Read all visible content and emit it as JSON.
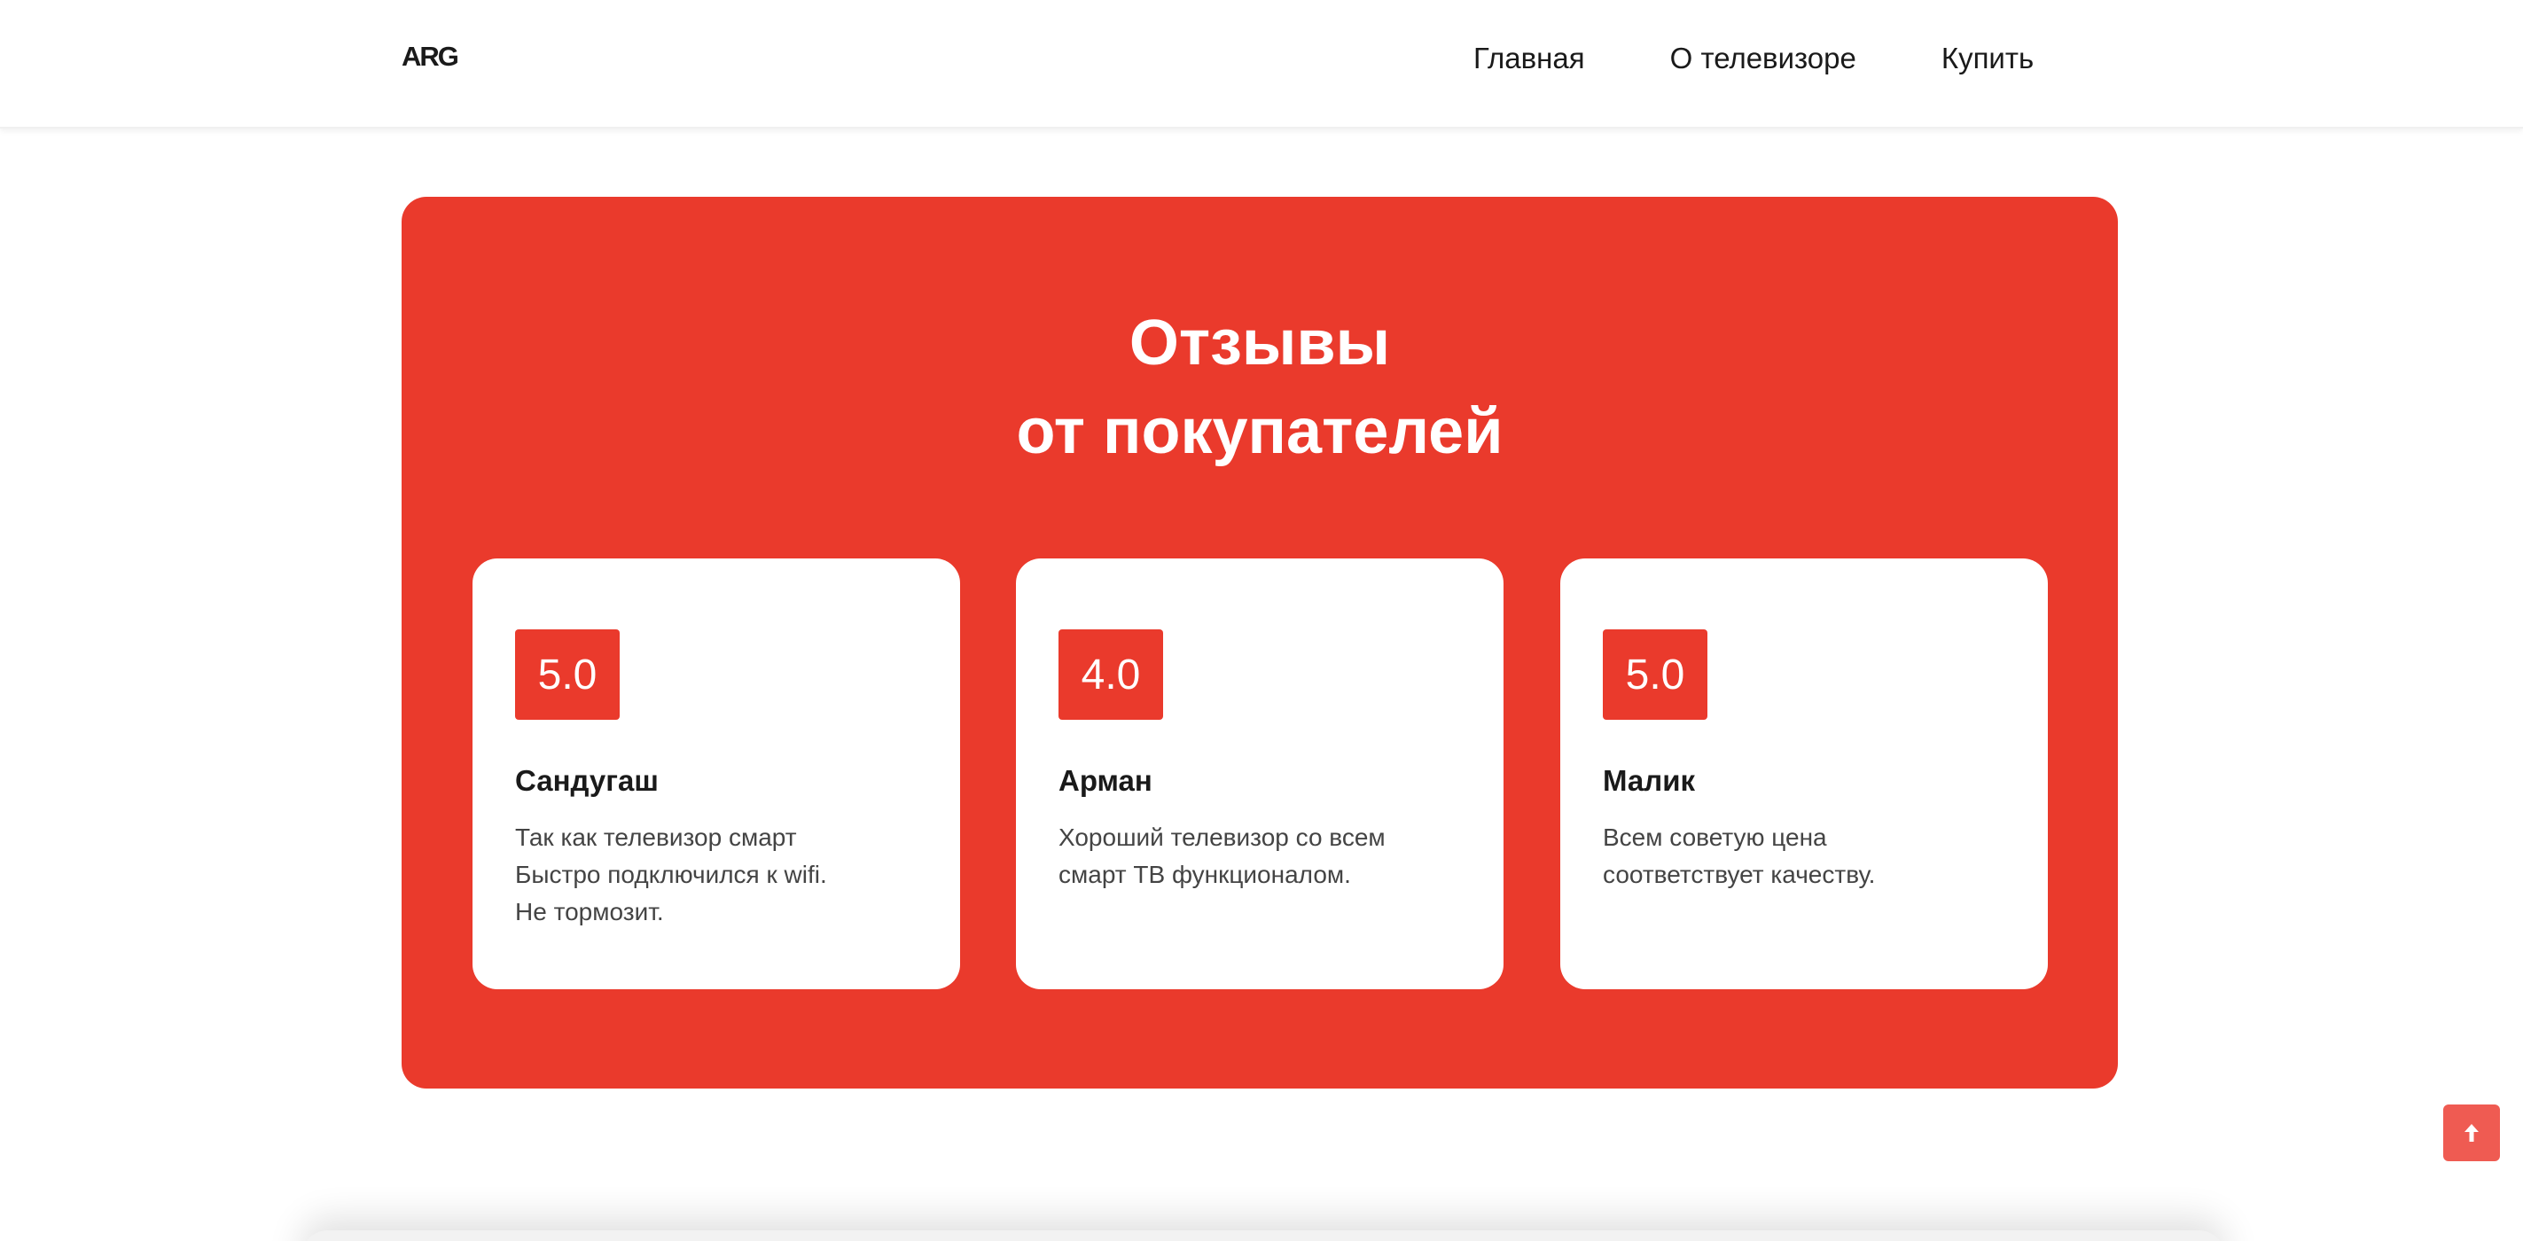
{
  "header": {
    "logo": "ARG",
    "nav": [
      "Главная",
      "О телевизоре",
      "Купить"
    ]
  },
  "reviews": {
    "title_line1": "Отзывы",
    "title_line2": "от покупателей",
    "accent_color": "#ea3a2c",
    "cards": [
      {
        "rating": "5.0",
        "name": "Сандугаш",
        "lines": [
          "Так как телевизор смарт",
          "Быстро подключился к wifi.",
          "Не тормозит."
        ]
      },
      {
        "rating": "4.0",
        "name": "Арман",
        "lines": [
          "Хороший телевизор со всем",
          "смарт ТВ функционалом."
        ]
      },
      {
        "rating": "5.0",
        "name": "Малик",
        "lines": [
          "Всем советую цена",
          "соответствует качеству."
        ]
      }
    ]
  },
  "scroll_top": {
    "icon": "arrow-up-icon"
  }
}
